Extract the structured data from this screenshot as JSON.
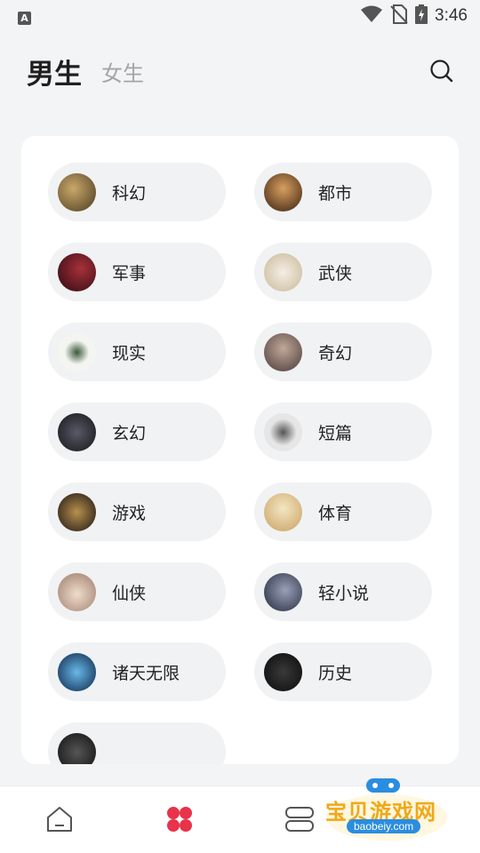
{
  "status_bar": {
    "notification_icon": "A",
    "time": "3:46",
    "icons": [
      "wifi-icon",
      "no-sim-icon",
      "battery-charging-icon"
    ]
  },
  "header": {
    "tabs": [
      {
        "label": "男生",
        "active": true
      },
      {
        "label": "女生",
        "active": false
      }
    ],
    "search_icon": "search-icon"
  },
  "categories": [
    {
      "label": "科幻",
      "thumb_color": "#6b5a3a"
    },
    {
      "label": "都市",
      "thumb_color": "#4a3020"
    },
    {
      "label": "军事",
      "thumb_color": "#6a1a22"
    },
    {
      "label": "武侠",
      "thumb_color": "#e8e2d8"
    },
    {
      "label": "现实",
      "thumb_color": "#f4f4f0"
    },
    {
      "label": "奇幻",
      "thumb_color": "#8a7a70"
    },
    {
      "label": "玄幻",
      "thumb_color": "#2a2a30"
    },
    {
      "label": "短篇",
      "thumb_color": "#e6e6e6"
    },
    {
      "label": "游戏",
      "thumb_color": "#2a2420"
    },
    {
      "label": "体育",
      "thumb_color": "#e8d4a8"
    },
    {
      "label": "仙侠",
      "thumb_color": "#d8c0b0"
    },
    {
      "label": "轻小说",
      "thumb_color": "#3a4058"
    },
    {
      "label": "诸天无限",
      "thumb_color": "#1a4a7a"
    },
    {
      "label": "历史",
      "thumb_color": "#1a1a1a"
    },
    {
      "label": "",
      "thumb_color": "#222222"
    }
  ],
  "bottom_nav": [
    {
      "name": "home",
      "icon": "home-icon",
      "active": false
    },
    {
      "name": "category",
      "icon": "category-grid-icon",
      "active": true,
      "color": "#e8334a"
    },
    {
      "name": "bookshelf",
      "icon": "bookshelf-icon",
      "active": false
    }
  ],
  "watermark": {
    "text": "宝贝游戏网",
    "sub": "baobeiy.com"
  }
}
